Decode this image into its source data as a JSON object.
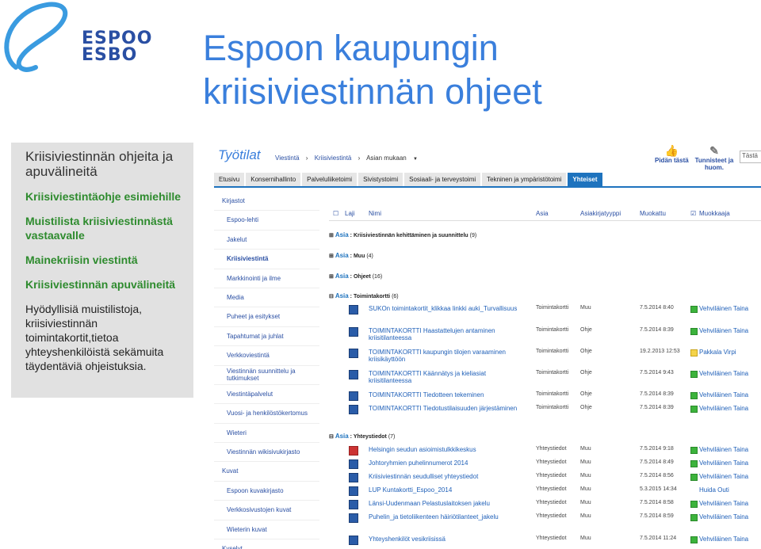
{
  "logo": {
    "line1": "ESPOO",
    "line2": "ESBO",
    "color": "#2a4fa3",
    "accent": "#3a9be0"
  },
  "title": {
    "line1": "Espoon kaupungin",
    "line2": "kriisiviestinnän ohjeet"
  },
  "left_panel": {
    "heading": "Kriisiviestinnän ohjeita ja apuvälineitä",
    "links": [
      "Kriisiviestintäohje esimiehille",
      "Muistilista kriisiviestinnästä vastaavalle",
      "Mainekriisin viestintä",
      "Kriisiviestinnän apuvälineitä"
    ],
    "text": "Hyödyllisiä muistilistoja, kriisiviestinnän toimintakortit,tietoa yhteyshenkilöistä sekämuita täydentäviä ohjeistuksia."
  },
  "app": {
    "brand": "Työtilat",
    "breadcrumbs": [
      "Viestintä",
      "Kriisiviestintä",
      "Asian mukaan"
    ],
    "actions": {
      "follow": "Pidän tästä",
      "tags": "Tunnisteet ja huom."
    },
    "search_placeholder": "Tästä",
    "tabs": [
      "Etusivu",
      "Konsernihallinto",
      "Palveluliiketoimi",
      "Sivistystoimi",
      "Sosiaali- ja terveystoimi",
      "Tekninen ja ympäristötoimi",
      "Yhteiset"
    ],
    "active_tab": "Yhteiset",
    "quicknav": [
      {
        "label": "Kirjastot",
        "type": "head"
      },
      {
        "label": "Espoo-lehti"
      },
      {
        "label": "Jakelut"
      },
      {
        "label": "Kriisiviestintä",
        "type": "bold"
      },
      {
        "label": "Markkinointi ja ilme"
      },
      {
        "label": "Media"
      },
      {
        "label": "Puheet ja esitykset"
      },
      {
        "label": "Tapahtumat ja juhlat"
      },
      {
        "label": "Verkkoviestintä"
      },
      {
        "label": "Viestinnän suunnittelu ja tutkimukset",
        "type": "two"
      },
      {
        "label": "Viestintäpalvelut"
      },
      {
        "label": "Vuosi- ja henkilöstökertomus"
      },
      {
        "label": "Wieteri"
      },
      {
        "label": "Viestinnän wikisivukirjasto"
      },
      {
        "label": "Kuvat",
        "type": "head"
      },
      {
        "label": "Espoon kuvakirjasto"
      },
      {
        "label": "Verkkosivustojen kuvat"
      },
      {
        "label": "Wieterin kuvat"
      },
      {
        "label": "Kyselyt",
        "type": "head"
      }
    ],
    "columns": [
      "Laji",
      "Nimi",
      "Asia",
      "Asiakirjatyyppi",
      "Muokattu",
      "Muokkaaja"
    ],
    "groups": [
      {
        "label": "Asia",
        "name": "Kriisiviestinnän kehittäminen ja suunnittelu",
        "count": "(9)",
        "sign": "⊞"
      },
      {
        "label": "Asia",
        "name": "Muu",
        "count": "(4)",
        "sign": "⊞"
      },
      {
        "label": "Asia",
        "name": "Ohjeet",
        "count": "(16)",
        "sign": "⊞"
      },
      {
        "label": "Asia",
        "name": "Toimintakortti",
        "count": "(6)",
        "sign": "⊟"
      },
      {
        "label": "Asia",
        "name": "Yhteystiedot",
        "count": "(7)",
        "sign": "⊟"
      }
    ],
    "rows": [
      {
        "name": "SUKOn toimintakortit_klikkaa linkki auki_Turvallisuus",
        "type": "Toimintakortti",
        "subject": "Muu",
        "modified": "7.5.2014 8:40",
        "by": "Vehviläinen Taina",
        "presence": "online",
        "icon": "word"
      },
      {
        "name": "TOIMINTAKORTTI Haastattelujen antaminen kriisitilanteessa",
        "type": "Toimintakortti",
        "subject": "Ohje",
        "modified": "7.5.2014 8:39",
        "by": "Vehviläinen Taina",
        "presence": "online",
        "icon": "word"
      },
      {
        "name": "TOIMINTAKORTTI kaupungin tilojen varaaminen kriisikäyttöön",
        "type": "Toimintakortti",
        "subject": "Ohje",
        "modified": "19.2.2013 12:53",
        "by": "Pakkala Virpi",
        "presence": "idle",
        "icon": "word"
      },
      {
        "name": "TOIMINTAKORTTI Käännätys ja kieliasiat kriisitilanteessa",
        "type": "Toimintakortti",
        "subject": "Ohje",
        "modified": "7.5.2014 9:43",
        "by": "Vehviläinen Taina",
        "presence": "online",
        "icon": "word"
      },
      {
        "name": "TOIMINTAKORTTI Tiedotteen tekeminen",
        "type": "Toimintakortti",
        "subject": "Ohje",
        "modified": "7.5.2014 8:39",
        "by": "Vehviläinen Taina",
        "presence": "online",
        "icon": "word"
      },
      {
        "name": "TOIMINTAKORTTI Tiedotustilaisuuden järjestäminen",
        "type": "Toimintakortti",
        "subject": "Ohje",
        "modified": "7.5.2014 8:39",
        "by": "Vehviläinen Taina",
        "presence": "online",
        "icon": "word"
      },
      {
        "name": "Helsingin seudun asioimistulkkikeskus",
        "type": "Yhteystiedot",
        "subject": "Muu",
        "modified": "7.5.2014 9:18",
        "by": "Vehviläinen Taina",
        "presence": "online",
        "icon": "pdf"
      },
      {
        "name": "Johtoryhmien puhelinnumerot 2014",
        "type": "Yhteystiedot",
        "subject": "Muu",
        "modified": "7.5.2014 8:49",
        "by": "Vehviläinen Taina",
        "presence": "online",
        "icon": "word"
      },
      {
        "name": "Kriisiviestinnän seudulliset yhteystiedot",
        "type": "Yhteystiedot",
        "subject": "Muu",
        "modified": "7.5.2014 8:56",
        "by": "Vehviläinen Taina",
        "presence": "online",
        "icon": "word"
      },
      {
        "name": "LUP Kuntakortti_Espoo_2014",
        "type": "Yhteystiedot",
        "subject": "Muu",
        "modified": "5.3.2015 14:34",
        "by": "Huida Outi",
        "presence": "none",
        "icon": "word"
      },
      {
        "name": "Länsi-Uudenmaan Pelastuslaitoksen jakelu",
        "type": "Yhteystiedot",
        "subject": "Muu",
        "modified": "7.5.2014 8:58",
        "by": "Vehviläinen Taina",
        "presence": "online",
        "icon": "word"
      },
      {
        "name": "Puhelin_ja tietoliikenteen häiriötilanteet_jakelu",
        "type": "Yhteystiedot",
        "subject": "Muu",
        "modified": "7.5.2014 8:59",
        "by": "Vehviläinen Taina",
        "presence": "online",
        "icon": "word"
      },
      {
        "name": "Yhteyshenkilöt vesikriisissä",
        "type": "Yhteystiedot",
        "subject": "Muu",
        "modified": "7.5.2014 11:24",
        "by": "Vehviläinen Taina",
        "presence": "online",
        "icon": "word"
      }
    ]
  }
}
